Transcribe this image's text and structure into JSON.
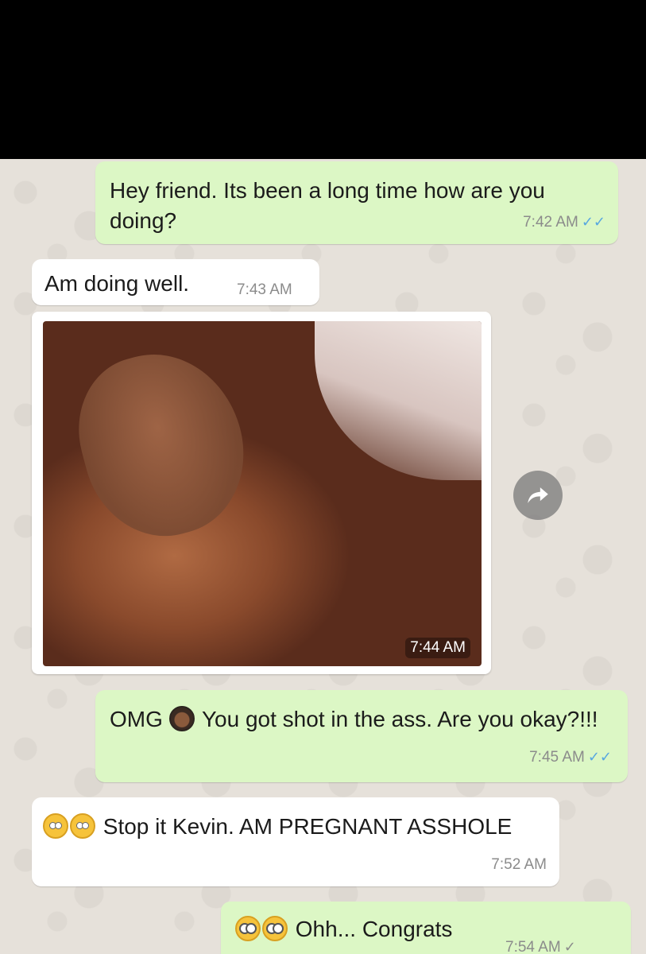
{
  "messages": [
    {
      "text": "Hey friend. Its been a long time how are you doing?",
      "time": "7:42 AM",
      "ticks": "✓✓"
    },
    {
      "text": "Am doing well.",
      "time": "7:43 AM"
    },
    {
      "time": "7:44 AM"
    },
    {
      "text_pre": "OMG",
      "text_post": "You got shot in the ass. Are you okay?!!!",
      "time": "7:45 AM",
      "ticks": "✓✓"
    },
    {
      "text": "Stop it Kevin. AM PREGNANT ASSHOLE",
      "time": "7:52 AM"
    },
    {
      "text": "Ohh... Congrats",
      "time": "7:54 AM",
      "ticks": "✓"
    }
  ],
  "icons": {
    "forward": "forward-arrow-icon",
    "read_receipt": "double-check-icon",
    "sent_receipt": "single-check-icon"
  },
  "colors": {
    "outgoing_bubble": "#dcf7c5",
    "incoming_bubble": "#ffffff",
    "chat_background": "#e6e1da",
    "read_ticks": "#57a7e0"
  }
}
